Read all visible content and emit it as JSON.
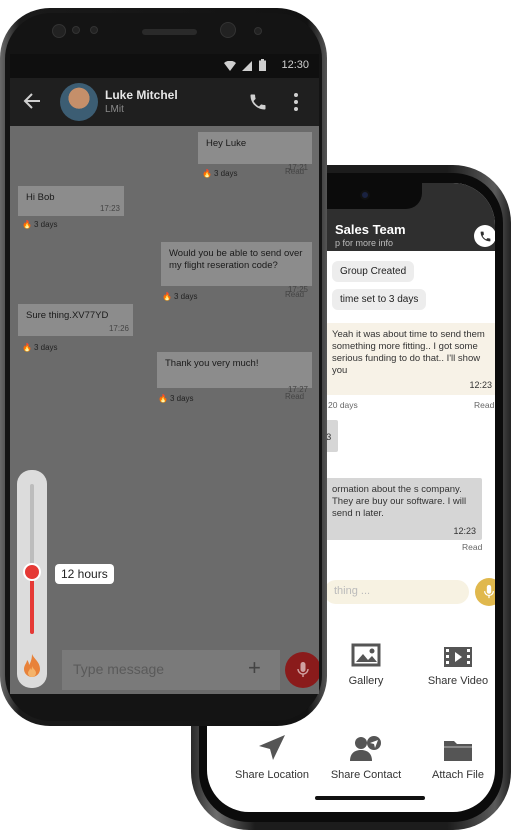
{
  "back_phone": {
    "header": {
      "title": "Sales Team",
      "subtitle": "p for more info"
    },
    "system_pills": [
      "Group Created",
      "time set to 3 days"
    ],
    "messages": [
      {
        "text": "Yeah it was about time to send them something more fitting.. I got some serious funding to do that.. I'll show you",
        "time": "12:23",
        "expiry": "20 days",
        "status": "Read"
      },
      {
        "text": "3"
      },
      {
        "text": "ormation about the s company. They are buy our software. I will send n later.",
        "time": "12:23",
        "status": "Read"
      }
    ],
    "input_placeholder": "thing ...",
    "attachments": [
      {
        "label": "Gallery",
        "icon": "gallery-icon"
      },
      {
        "label": "Share Video",
        "icon": "video-icon"
      },
      {
        "label": "Share Location",
        "icon": "location-icon"
      },
      {
        "label": "Share Contact",
        "icon": "contact-icon"
      },
      {
        "label": "Attach File",
        "icon": "folder-icon"
      }
    ]
  },
  "front_phone": {
    "status_time": "12:30",
    "header": {
      "name": "Luke Mitchel",
      "username": "LMit"
    },
    "messages": [
      {
        "direction": "out",
        "text": "Hey Luke",
        "time": "17:21",
        "status": "Read",
        "expiry": "3 days"
      },
      {
        "direction": "in",
        "text": "Hi Bob",
        "time": "17:23",
        "expiry": "3 days"
      },
      {
        "direction": "out",
        "text": "Would you be able to send over my flight reseration code?",
        "time": "17:25",
        "status": "Read",
        "expiry": "3 days"
      },
      {
        "direction": "in",
        "text": "Sure thing.XV77YD",
        "time": "17:26",
        "expiry": "3 days"
      },
      {
        "direction": "out",
        "text": "Thank you very much!",
        "time": "17:27",
        "status": "Read",
        "expiry": "3 days"
      }
    ],
    "self_destruct": {
      "duration_label": "12 hours",
      "level": 0.43
    },
    "input_placeholder": "Type message"
  },
  "colors": {
    "accent_red": "#e53935",
    "mic_gold": "#e0b84d",
    "header_dark": "#1f1f1f"
  }
}
